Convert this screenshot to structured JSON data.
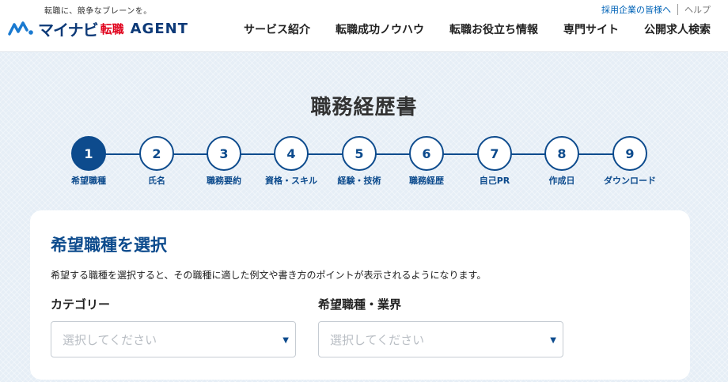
{
  "header": {
    "tagline": "転職に、競争なブレーンを。",
    "logo": {
      "mynavi": "マイナビ",
      "tenshoku": "転職",
      "agent": "AGENT"
    },
    "util_links": [
      "採用企業の皆様へ",
      "ヘルプ"
    ],
    "nav": [
      "サービス紹介",
      "転職成功ノウハウ",
      "転職お役立ち情報",
      "専門サイト",
      "公開求人検索"
    ]
  },
  "page": {
    "title": "職務経歴書"
  },
  "stepper": {
    "active": 1,
    "steps": [
      {
        "num": "1",
        "label": "希望職種"
      },
      {
        "num": "2",
        "label": "氏名"
      },
      {
        "num": "3",
        "label": "職務要約"
      },
      {
        "num": "4",
        "label": "資格・スキル"
      },
      {
        "num": "5",
        "label": "経験・技術"
      },
      {
        "num": "6",
        "label": "職務経歴"
      },
      {
        "num": "7",
        "label": "自己PR"
      },
      {
        "num": "8",
        "label": "作成日"
      },
      {
        "num": "9",
        "label": "ダウンロード"
      }
    ]
  },
  "form": {
    "title": "希望職種を選択",
    "description": "希望する職種を選択すると、その職種に適した例文や書き方のポイントが表示されるようになります。",
    "category": {
      "label": "カテゴリー",
      "placeholder": "選択してください"
    },
    "job_type": {
      "label": "希望職種・業界",
      "placeholder": "選択してください"
    },
    "caret": "▼"
  },
  "colors": {
    "primary": "#0d4b8d",
    "brand_red": "#e0001b",
    "link": "#0063b7"
  }
}
